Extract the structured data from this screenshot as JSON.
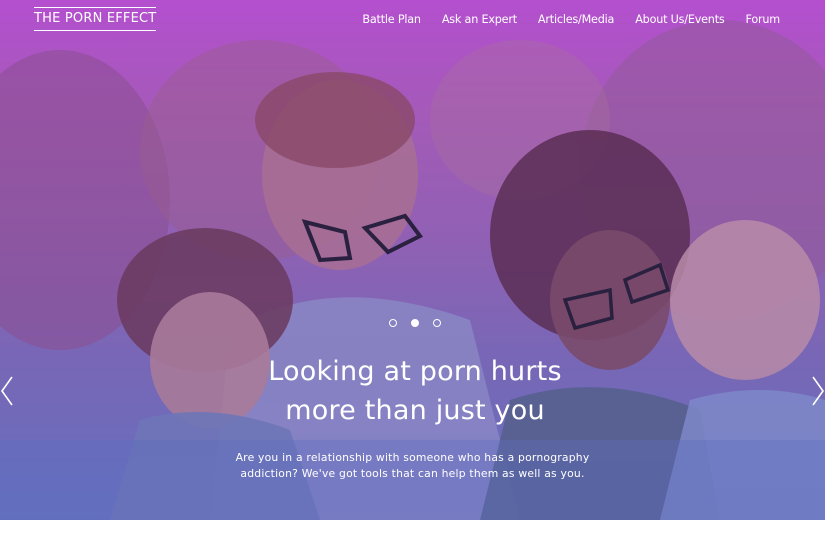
{
  "site": {
    "logo": "THE PORN EFFECT"
  },
  "nav": {
    "items": [
      "Battle Plan",
      "Ask an Expert",
      "Articles/Media",
      "About Us/Events",
      "Forum"
    ]
  },
  "slider": {
    "dots": 3,
    "active_dot": 2,
    "headline_line1": "Looking at porn hurts",
    "headline_line2": "more than just you",
    "subtext_line1": "Are you in a relationship with someone who has a pornography",
    "subtext_line2": "addiction? We've got tools that can help them as well as you.",
    "prev_icon": "chevron-left-icon",
    "next_icon": "chevron-right-icon"
  },
  "colors": {
    "overlay_top": "#b44fcf",
    "overlay_bottom": "#6670bf",
    "text": "#ffffff"
  }
}
